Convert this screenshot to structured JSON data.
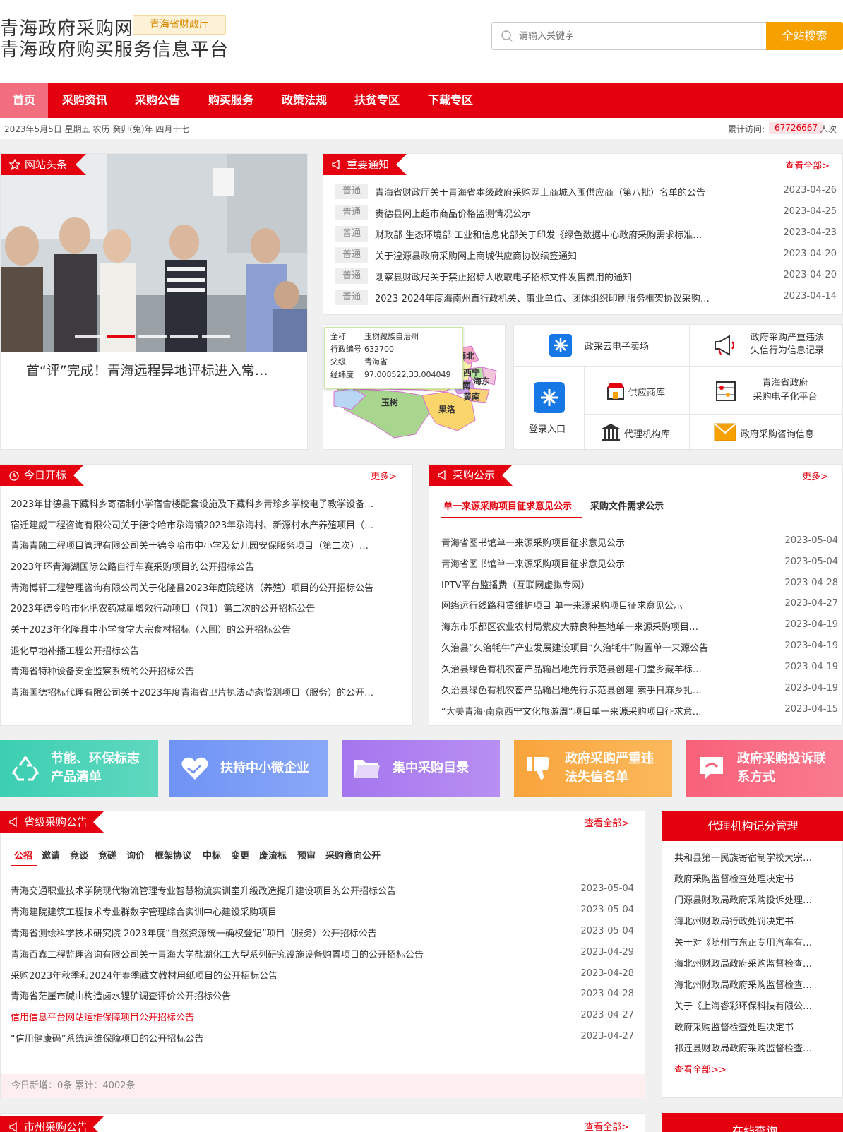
{
  "header": {
    "title_line1": "青海政府采购网",
    "title_line2": "青海政府购买服务信息平台",
    "dept_badge": "青海省财政厅",
    "search_placeholder": "请输入关键字",
    "search_button": "全站搜索"
  },
  "nav": {
    "items": [
      "首页",
      "采购资讯",
      "采购公告",
      "购买服务",
      "政策法规",
      "扶贫专区",
      "下载专区"
    ]
  },
  "datebar": {
    "date": "2023年5月5日 星期五 农历 癸卯(兔)年 四月十七",
    "visit_label": "累计访问:",
    "visit_count": "67726667",
    "visit_unit": "人次"
  },
  "headline": {
    "label": "网站头条",
    "caption": "首“评”完成！青海远程异地评标进入常…",
    "active_slide": 2,
    "slide_count": 5
  },
  "notices": {
    "label": "重要通知",
    "more": "查看全部>",
    "tag": "普通",
    "items": [
      {
        "title": "青海省财政厅关于青海省本级政府采购网上商城入围供应商（第八批）名单的公告",
        "date": "2023-04-26"
      },
      {
        "title": "贵德县网上超市商品价格监测情况公示",
        "date": "2023-04-25"
      },
      {
        "title": "财政部 生态环境部 工业和信息化部关于印发《绿色数据中心政府采购需求标准…",
        "date": "2023-04-23"
      },
      {
        "title": "关于湟源县政府采购网上商城供应商协议续签通知",
        "date": "2023-04-20"
      },
      {
        "title": "刚察县财政局关于禁止招标人收取电子招标文件发售费用的通知",
        "date": "2023-04-20"
      },
      {
        "title": "2023-2024年度海南州直行政机关、事业单位、团体组织印刷服务框架协议采购…",
        "date": "2023-04-14"
      }
    ]
  },
  "map": {
    "tooltip": {
      "fullname_label": "全称",
      "fullname": "玉树藏族自治州",
      "code_label": "行政编号",
      "code": "632700",
      "parent_label": "父级",
      "parent": "青海省",
      "coord_label": "经纬度",
      "coord": "97.008522,33.004049"
    },
    "regions": [
      "海北",
      "西宁",
      "海东",
      "海南",
      "黄南",
      "玉树",
      "果洛"
    ]
  },
  "quick_links": {
    "cloud_market": "政采云电子卖场",
    "blacklist_line1": "政府采购严重违法",
    "blacklist_line2": "失信行为信息记录",
    "login": "登录入口",
    "supplier": "供应商库",
    "platform_line1": "青海省政府",
    "platform_line2": "采购电子化平台",
    "agency": "代理机构库",
    "consult": "政府采购咨询信息"
  },
  "today_bids": {
    "label": "今日开标",
    "more": "更多>",
    "items": [
      "2023年甘德县下藏科乡寄宿制小学宿舍楼配套设施及下藏科乡青珍乡学校电子教学设备…",
      "宿迁建威工程咨询有限公司关于德令哈市尕海镇2023年尕海村、新源村水产养殖项目（…",
      "青海青融工程项目管理有限公司关于德令哈市中小学及幼儿园安保服务项目（第二次）…",
      "2023年环青海湖国际公路自行车赛采购项目的公开招标公告",
      "青海博轩工程管理咨询有限公司关于化隆县2023年庭院经济（养殖）项目的公开招标公告",
      "2023年德令哈市化肥农药减量增效行动项目（包1）第二次的公开招标公告",
      "关于2023年化隆县中小学食堂大宗食材招标（入围）的公开招标公告",
      "退化草地补播工程公开招标公告",
      "青海省特种设备安全监察系统的公开招标公告",
      "青海国德招标代理有限公司关于2023年度青海省卫片执法动态监测项目（服务）的公开…"
    ]
  },
  "publicity": {
    "label": "采购公示",
    "more": "更多>",
    "tabs": [
      "单一来源采购项目征求意见公示",
      "采购文件需求公示"
    ],
    "items": [
      {
        "title": "青海省图书馆单一来源采购项目征求意见公示",
        "date": "2023-05-04"
      },
      {
        "title": "青海省图书馆单一来源采购项目征求意见公示",
        "date": "2023-05-04"
      },
      {
        "title": "IPTV平台监播费（互联网虚拟专网）",
        "date": "2023-04-28"
      },
      {
        "title": "网络运行线路租赁维护项目 单一来源采购项目征求意见公示",
        "date": "2023-04-27"
      },
      {
        "title": "海东市乐都区农业农村局紫皮大蒜良种基地单一来源采购项目…",
        "date": "2023-04-19"
      },
      {
        "title": "久治县“久治牦牛”产业发展建设项目“久治牦牛”购置单一来源公告",
        "date": "2023-04-19"
      },
      {
        "title": "久治县绿色有机农畜产品输出地先行示范县创建-门堂乡藏羊标…",
        "date": "2023-04-19"
      },
      {
        "title": "久治县绿色有机农畜产品输出地先行示范县创建-索乎日麻乡扎…",
        "date": "2023-04-19"
      },
      {
        "title": "“大美青海·南京西宁文化旅游周”项目单一来源采购项目征求意…",
        "date": "2023-04-15"
      }
    ]
  },
  "banners": {
    "green_line1": "节能、环保标志",
    "green_line2": "产品清单",
    "sme": "扶持中小微企业",
    "catalog": "集中采购目录",
    "blacklist_line1": "政府采购严重违",
    "blacklist_line2": "法失信名单",
    "complaint_line1": "政府采购投诉联",
    "complaint_line2": "系方式",
    "colors": {
      "green": "#3ccfb2",
      "blue": "#6f93f5",
      "purple": "#a476ee",
      "orange": "#f9a43c",
      "pink": "#f8617a"
    }
  },
  "provincial": {
    "label": "省级采购公告",
    "more": "查看全部>",
    "tabs": [
      "公招",
      "邀请",
      "竞谈",
      "竞磋",
      "询价",
      "框架协议",
      "中标",
      "变更",
      "废流标",
      "预审",
      "采购意向公开"
    ],
    "items": [
      {
        "title": "青海交通职业技术学院现代物流管理专业智慧物流实训室升级改造提升建设项目的公开招标公告",
        "date": "2023-05-04"
      },
      {
        "title": "青海建院建筑工程技术专业群数字管理综合实训中心建设采购项目",
        "date": "2023-05-04"
      },
      {
        "title": "青海省测绘科学技术研究院 2023年度“自然资源统一确权登记”项目（服务）公开招标公告",
        "date": "2023-05-04"
      },
      {
        "title": "青海百鑫工程监理咨询有限公司关于青海大学盐湖化工大型系列研究设施设备购置项目的公开招标公告",
        "date": "2023-04-29"
      },
      {
        "title": "采购2023年秋季和2024年春季藏文教材用纸项目的公开招标公告",
        "date": "2023-04-28"
      },
      {
        "title": "青海省茫崖市碱山构造卤水锂矿调查评价公开招标公告",
        "date": "2023-04-28"
      },
      {
        "title": "信用信息平台网站运维保障项目公开招标公告",
        "date": "2023-04-27"
      },
      {
        "title": "“信用健康码”系统运维保障项目的公开招标公告",
        "date": "2023-04-27"
      }
    ],
    "footer": "今日新增：0条 累计：4002条"
  },
  "agency": {
    "title": "代理机构记分管理",
    "items": [
      "共和县第一民族寄宿制学校大宗…",
      " 政府采购监督检查处理决定书",
      "门源县财政局政府采购投诉处理…",
      "海北州财政局行政处罚决定书",
      "关于对《随州市东正专用汽车有…",
      "海北州财政局政府采购监督检查…",
      "海北州财政局政府采购监督检查…",
      "关于《上海睿彩环保科技有限公…",
      "政府采购监督检查处理决定书",
      "祁连县财政局政府采购监督检查…"
    ],
    "more": "查看全部>>"
  },
  "city": {
    "label": "市州采购公告",
    "more": "查看全部>"
  },
  "online": {
    "title": "在线查询"
  }
}
